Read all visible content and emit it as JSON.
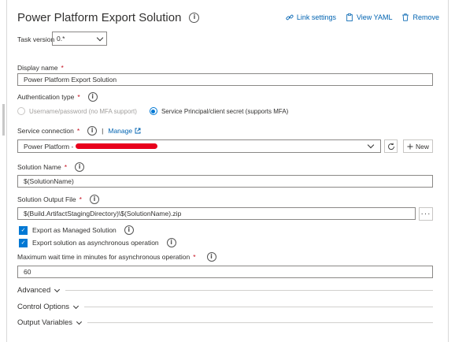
{
  "header": {
    "title": "Power Platform Export Solution",
    "link_settings": "Link settings",
    "view_yaml": "View YAML",
    "remove": "Remove"
  },
  "task_version": {
    "label": "Task version",
    "value": "0.*"
  },
  "display_name": {
    "label": "Display name",
    "value": "Power Platform Export Solution"
  },
  "auth": {
    "label": "Authentication type",
    "options": [
      "Username/password (no MFA support)",
      "Service Principal/client secret (supports MFA)"
    ],
    "selected": "Service Principal/client secret (supports MFA)"
  },
  "service_connection": {
    "label": "Service connection",
    "manage": "Manage",
    "value": "Power Platform - ",
    "new_label": "New"
  },
  "solution_name": {
    "label": "Solution Name",
    "value": "$(SolutionName)"
  },
  "solution_output": {
    "label": "Solution Output File",
    "value": "$(Build.ArtifactStagingDirectory)\\$(SolutionName).zip",
    "more": "···"
  },
  "checkboxes": {
    "managed": "Export as Managed Solution",
    "async": "Export solution as asynchronous operation"
  },
  "max_wait": {
    "label": "Maximum wait time in minutes for asynchronous operation",
    "value": "60"
  },
  "required_mark": "*",
  "sections": {
    "advanced": "Advanced",
    "control_options": "Control Options",
    "output_variables": "Output Variables"
  },
  "colors": {
    "accent": "#0078d4",
    "link": "#0063b1",
    "required": "#c50f1f",
    "redaction": "#e8001c"
  }
}
